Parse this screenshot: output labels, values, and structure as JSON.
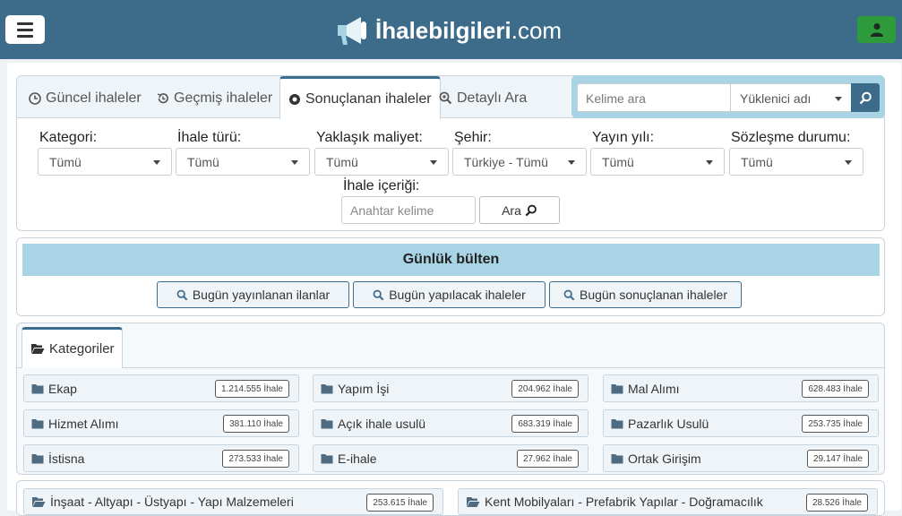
{
  "header": {
    "logo_bold": "İhalebilgileri",
    "logo_suffix": ".com",
    "bg_color": "#3d6b8a",
    "user_btn_color": "#2d9a3b"
  },
  "tabs": {
    "guncel": "Güncel ihaleler",
    "gecmis": "Geçmiş ihaleler",
    "sonuclanan": "Sonuçlanan ihaleler",
    "detayli": "Detaylı Ara"
  },
  "search": {
    "keyword_placeholder": "Kelime ara",
    "contractor_select": "Yüklenici adı"
  },
  "filters": {
    "kategori": {
      "label": "Kategori:",
      "value": "Tümü"
    },
    "ihale_turu": {
      "label": "İhale türü:",
      "value": "Tümü"
    },
    "maliyet": {
      "label": "Yaklaşık maliyet:",
      "value": "Tümü"
    },
    "sehir": {
      "label": "Şehir:",
      "value": "Türkiye - Tümü"
    },
    "yayin_yili": {
      "label": "Yayın yılı:",
      "value": "Tümü"
    },
    "sozlesme": {
      "label": "Sözleşme durumu:",
      "value": "Tümü"
    },
    "icerik": {
      "label": "İhale içeriği:",
      "placeholder": "Anahtar kelime"
    },
    "ara_button": "Ara"
  },
  "bulten": {
    "title": "Günlük bülten",
    "btn1": "Bugün yayınlanan ilanlar",
    "btn2": "Bugün yapılacak ihaleler",
    "btn3": "Bugün sonuçlanan ihaleler"
  },
  "kategoriler": {
    "tab_label": "Kategoriler",
    "items": [
      {
        "name": "Ekap",
        "count": "1.214.555 İhale"
      },
      {
        "name": "Yapım İşi",
        "count": "204.962 İhale"
      },
      {
        "name": "Mal Alımı",
        "count": "628.483 İhale"
      },
      {
        "name": "Hizmet Alımı",
        "count": "381.110 İhale"
      },
      {
        "name": "Açık ihale usulü",
        "count": "683.319 İhale"
      },
      {
        "name": "Pazarlık Usulü",
        "count": "253.735 İhale"
      },
      {
        "name": "İstisna",
        "count": "273.533 İhale"
      },
      {
        "name": "E-ihale",
        "count": "27.962 İhale"
      },
      {
        "name": "Ortak Girişim",
        "count": "29.147 İhale"
      }
    ],
    "sub": [
      {
        "name": "İnşaat - Altyapı - Üstyapı - Yapı Malzemeleri",
        "count": "253.615 İhale"
      },
      {
        "name": "Kent Mobilyaları - Prefabrik Yapılar - Doğramacılık",
        "count": "28.526 İhale"
      }
    ]
  }
}
